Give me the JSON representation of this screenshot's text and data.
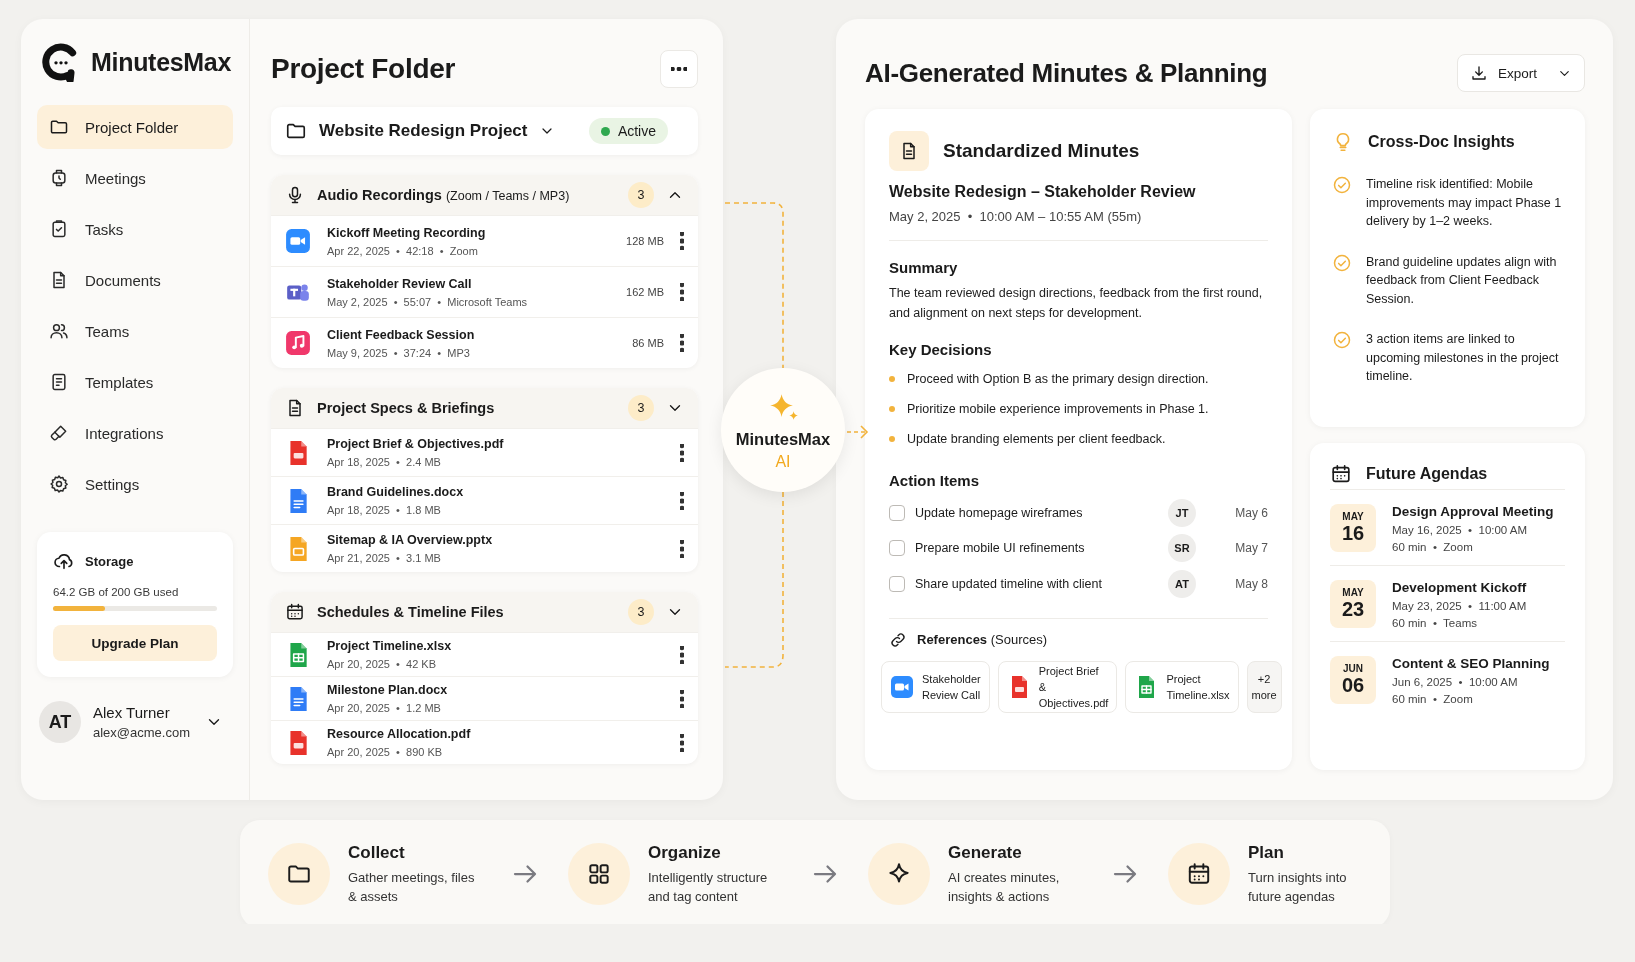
{
  "brand": {
    "name": "MinutesMax"
  },
  "sidebar": {
    "items": [
      {
        "label": "Project Folder",
        "selected": true
      },
      {
        "label": "Meetings",
        "selected": false
      },
      {
        "label": "Tasks",
        "selected": false
      },
      {
        "label": "Documents",
        "selected": false
      },
      {
        "label": "Teams",
        "selected": false
      },
      {
        "label": "Templates",
        "selected": false
      },
      {
        "label": "Integrations",
        "selected": false
      },
      {
        "label": "Settings",
        "selected": false
      }
    ]
  },
  "storage": {
    "title": "Storage",
    "usage": "64.2 GB of 200 GB used",
    "level": 0.32,
    "button": "Upgrade Plan"
  },
  "user": {
    "initials": "AT",
    "name": "Alex Turner",
    "email": "alex@acme.com"
  },
  "folder": {
    "title": "Project Folder",
    "project": "Website Redesign Project",
    "status": "Active",
    "groups": [
      {
        "title": "Audio Recordings",
        "subtitle": "(Zoom / Teams / MP3)",
        "count": "3",
        "expanded": true,
        "files": [
          {
            "kind": "zoom",
            "name": "Kickoff Meeting Recording",
            "meta": "Apr 22, 2025  •  42:18  •  Zoom",
            "size": "128 MB"
          },
          {
            "kind": "teams",
            "name": "Stakeholder Review Call",
            "meta": "May 2, 2025  •  55:07  •  Microsoft Teams",
            "size": "162 MB"
          },
          {
            "kind": "mp3",
            "name": "Client Feedback Session",
            "meta": "May 9, 2025  •  37:24  •  MP3",
            "size": "86 MB"
          }
        ]
      },
      {
        "title": "Project Specs & Briefings",
        "count": "3",
        "expanded": false,
        "files": [
          {
            "kind": "pdf",
            "name": "Project Brief & Objectives.pdf",
            "meta": "Apr 18, 2025  •  2.4 MB"
          },
          {
            "kind": "docx",
            "name": "Brand Guidelines.docx",
            "meta": "Apr 18, 2025  •  1.8 MB"
          },
          {
            "kind": "pptx",
            "name": "Sitemap & IA Overview.pptx",
            "meta": "Apr 21, 2025  •  3.1 MB"
          }
        ]
      },
      {
        "title": "Schedules & Timeline Files",
        "count": "3",
        "expanded": false,
        "files": [
          {
            "kind": "xlsx",
            "name": "Project Timeline.xlsx",
            "meta": "Apr 20, 2025  •  42 KB"
          },
          {
            "kind": "docx",
            "name": "Milestone Plan.docx",
            "meta": "Apr 20, 2025  •  1.2 MB"
          },
          {
            "kind": "pdf",
            "name": "Resource Allocation.pdf",
            "meta": "Apr 20, 2025  •  890 KB"
          }
        ]
      }
    ]
  },
  "hub": {
    "name": "MinutesMax",
    "tag": "AI"
  },
  "panel": {
    "title": "AI-Generated Minutes & Planning",
    "export": "Export"
  },
  "minutes": {
    "title": "Standardized Minutes",
    "meeting": "Website Redesign – Stakeholder Review",
    "when": "May 2, 2025  •  10:00 AM – 10:55 AM (55m)",
    "summary_title": "Summary",
    "summary": "The team reviewed design directions, feedback from the first round, and alignment on next steps for development.",
    "decisions_title": "Key Decisions",
    "decisions": [
      "Proceed with Option B as the primary design direction.",
      "Prioritize mobile experience improvements in Phase 1.",
      "Update branding elements per client feedback."
    ],
    "actions_title": "Action Items",
    "actions": [
      {
        "label": "Update homepage wireframes",
        "checked": false,
        "assignee": "JT",
        "due": "May 6"
      },
      {
        "label": "Prepare mobile UI refinements",
        "checked": false,
        "assignee": "SR",
        "due": "May 7"
      },
      {
        "label": "Share updated timeline with client",
        "checked": false,
        "assignee": "AT",
        "due": "May 8"
      }
    ],
    "references_title": "References",
    "references_note": "(Sources)",
    "references": [
      {
        "kind": "zoom",
        "label": "Stakeholder Review Call"
      },
      {
        "kind": "pdf",
        "label": "Project Brief & Objectives.pdf"
      },
      {
        "kind": "xlsx",
        "label": "Project Timeline.xlsx"
      },
      {
        "kind": "more",
        "label": "+2 more"
      }
    ]
  },
  "insights": {
    "title": "Cross-Doc Insights",
    "items": [
      "Timeline risk identified: Mobile improvements may impact Phase 1 delivery by 1–2 weeks.",
      "Brand guideline updates align with feedback from Client Feedback Session.",
      "3 action items are linked to upcoming milestones in the project timeline."
    ]
  },
  "agendas": {
    "title": "Future Agendas",
    "items": [
      {
        "month": "MAY",
        "day": "16",
        "title": "Design Approval Meeting",
        "when": "May 16, 2025  •  10:00 AM",
        "detail": "60 min  •  Zoom"
      },
      {
        "month": "MAY",
        "day": "23",
        "title": "Development Kickoff",
        "when": "May 23, 2025  •  11:00 AM",
        "detail": "60 min  •  Teams"
      },
      {
        "month": "JUN",
        "day": "06",
        "title": "Content & SEO Planning",
        "when": "Jun 6, 2025  •  10:00 AM",
        "detail": "60 min  •  Zoom"
      }
    ]
  },
  "steps": [
    {
      "title": "Collect",
      "text": "Gather meetings, files & assets"
    },
    {
      "title": "Organize",
      "text": "Intelligently structure and tag content"
    },
    {
      "title": "Generate",
      "text": "AI creates minutes, insights & actions"
    },
    {
      "title": "Plan",
      "text": "Turn insights into future agendas"
    }
  ]
}
